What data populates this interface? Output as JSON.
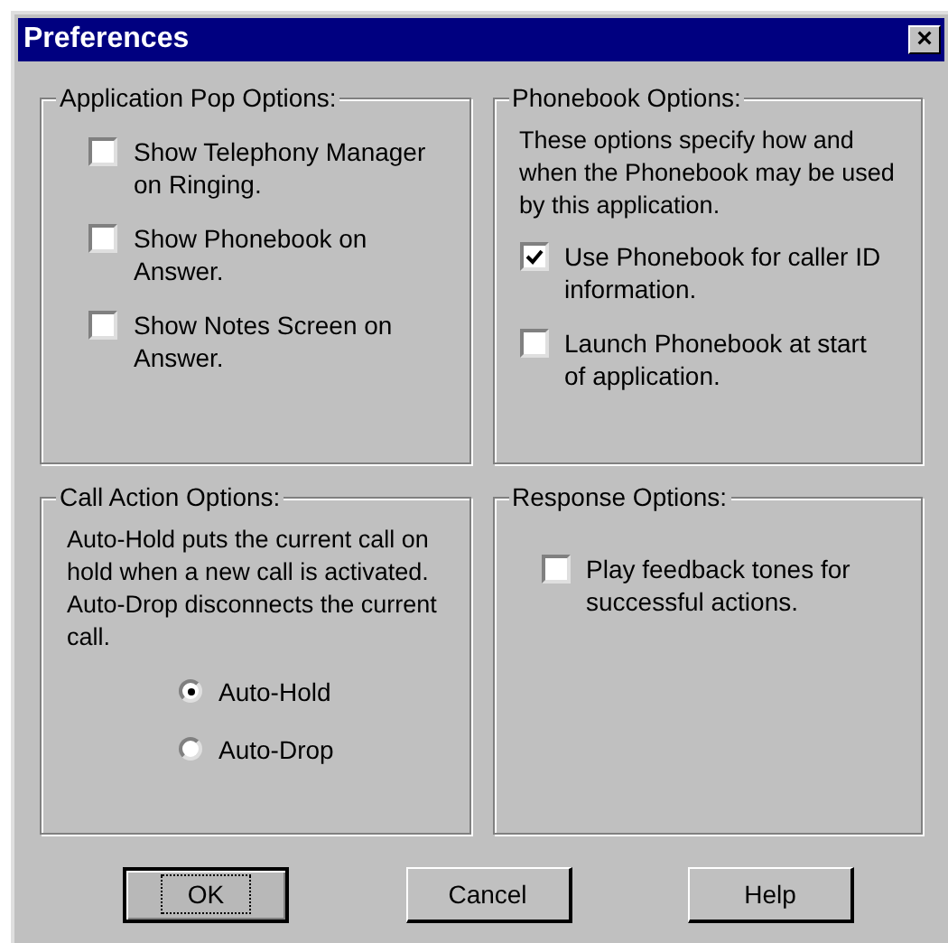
{
  "window": {
    "title": "Preferences",
    "close": "×"
  },
  "groups": [
    {
      "title": "Application Pop Options:",
      "kind": "checks",
      "items": [
        {
          "label": "Show Telephony Manager on Ringing.",
          "checked": false
        },
        {
          "label": "Show Phonebook on Answer.",
          "checked": false
        },
        {
          "label": "Show Notes Screen on Answer.",
          "checked": false
        }
      ]
    },
    {
      "title": "Phonebook Options:",
      "kind": "checks",
      "description": "These options specify how and when the Phonebook may be used by this application.",
      "items": [
        {
          "label": "Use Phonebook for caller ID information.",
          "checked": true
        },
        {
          "label": "Launch Phonebook at start of application.",
          "checked": false
        }
      ]
    },
    {
      "title": "Call Action Options:",
      "kind": "radios",
      "description": "Auto-Hold puts the current call on hold when a new call is activated.  Auto-Drop disconnects the current call.",
      "items": [
        {
          "label": "Auto-Hold",
          "selected": true
        },
        {
          "label": "Auto-Drop",
          "selected": false
        }
      ]
    },
    {
      "title": "Response Options:",
      "kind": "checks",
      "items": [
        {
          "label": "Play feedback tones for successful actions.",
          "checked": false
        }
      ]
    }
  ],
  "buttons": [
    {
      "label": "OK",
      "focused": true
    },
    {
      "label": "Cancel",
      "focused": false
    },
    {
      "label": "Help",
      "focused": false
    }
  ]
}
